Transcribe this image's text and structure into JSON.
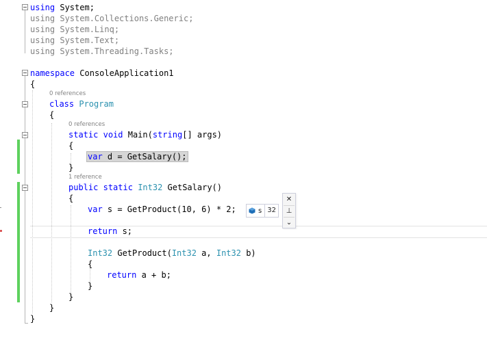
{
  "code": {
    "using": [
      "using",
      "System;",
      "System.Collections.Generic;",
      "System.Linq;",
      "System.Text;",
      "System.Threading.Tasks;"
    ],
    "namespace_kw": "namespace",
    "namespace_name": "ConsoleApplication1",
    "open_brace": "{",
    "close_brace": "}",
    "class_kw": "class",
    "class_name": "Program",
    "static_kw": "static",
    "void_kw": "void",
    "main_sig": "Main(",
    "string_kw": "string",
    "main_args": "[] args)",
    "var_kw": "var",
    "main_body_rest": " d = GetSalary();",
    "public_kw": "public",
    "int32": "Int32",
    "getsalary_sig": " GetSalary()",
    "s_decl_rest": " s = GetProduct(10, 6) * 2;",
    "return_kw": "return",
    "return_s_rest": " s;",
    "getproduct_sig_a": " GetProduct(",
    "getproduct_sig_b": " a, ",
    "getproduct_sig_c": " b)",
    "return_ab_rest": " a + b;"
  },
  "codelens": {
    "program_refs": "0 references",
    "main_refs": "0 references",
    "getsalary_refs": "1 reference"
  },
  "datatip": {
    "variable_name": "s",
    "variable_value": "32",
    "icon": "local-variable-icon",
    "close_glyph": "✕",
    "pin_glyph": "⊥",
    "expand_glyph": "⌄"
  }
}
